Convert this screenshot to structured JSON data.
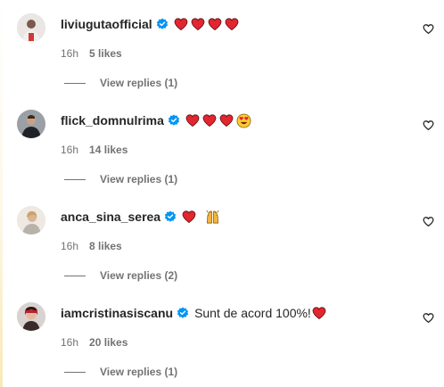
{
  "comments": [
    {
      "username": "liviugutaofficial",
      "text": "",
      "hearts": 4,
      "emojis": [],
      "time": "16h",
      "likes": "5 likes",
      "replies": "View replies (1)"
    },
    {
      "username": "flick_domnulrima",
      "text": "",
      "hearts": 3,
      "emojis": [
        "heart-eyes-emoji"
      ],
      "time": "16h",
      "likes": "14 likes",
      "replies": "View replies (1)"
    },
    {
      "username": "anca_sina_serea",
      "text": "",
      "hearts": 1,
      "emojis": [
        "raising-hands-emoji"
      ],
      "time": "16h",
      "likes": "8 likes",
      "replies": "View replies (2)"
    },
    {
      "username": "iamcristinasiscanu",
      "text": "Sunt de acord 100%!",
      "hearts": 1,
      "emojis": [],
      "time": "16h",
      "likes": "20 likes",
      "replies": "View replies (1)"
    }
  ],
  "colors": {
    "verified": "#0095f6",
    "heart": "#e2262f",
    "meta": "#737373",
    "text": "#262626"
  }
}
